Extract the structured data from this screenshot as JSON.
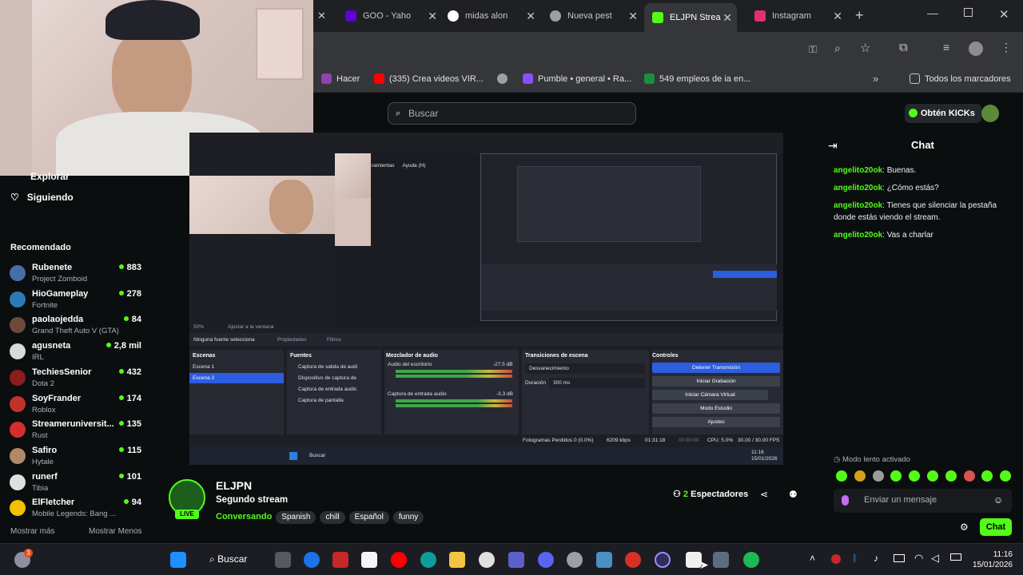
{
  "browser": {
    "tabs": [
      {
        "label": "GOO - Yaho",
        "fav_color": "#6001d2"
      },
      {
        "label": "midas alon",
        "fav_color": "#ffffff"
      },
      {
        "label": "Nueva pest",
        "fav_color": "#9aa0a6"
      },
      {
        "label": "ELJPN Strea",
        "fav_color": "#53fc18"
      },
      {
        "label": "Instagram",
        "fav_color": "#e1306c"
      }
    ],
    "bookmarks": [
      {
        "label": "Hacer",
        "color": "#8e44ad"
      },
      {
        "label": "(335) Crea videos VIR...",
        "color": "#ff0000"
      },
      {
        "label": "Pumble • general • Ra...",
        "color": "#8a4fff"
      },
      {
        "label": "549 empleos de ia en...",
        "color": "#1e8e3e"
      }
    ],
    "all_bookmarks": "Todos los marcadores"
  },
  "header": {
    "search_placeholder": "Buscar",
    "get_kicks": "Obtén KICKs"
  },
  "sidebar": {
    "explore": "Explorar",
    "following": "Siguiendo",
    "recommended": "Recomendado",
    "channels": [
      {
        "name": "Rubenete",
        "game": "Project Zomboid",
        "viewers": "883",
        "color": "#4a6da7"
      },
      {
        "name": "HioGameplay",
        "game": "Fortnite",
        "viewers": "278",
        "color": "#2d7ab5"
      },
      {
        "name": "paolaojedda",
        "game": "Grand Theft Auto V (GTA)",
        "viewers": "84",
        "color": "#6b4a3a"
      },
      {
        "name": "agusneta",
        "game": "IRL",
        "viewers": "2,8 mil",
        "color": "#d9d9d9"
      },
      {
        "name": "TechiesSenior",
        "game": "Dota 2",
        "viewers": "432",
        "color": "#8c1d1d"
      },
      {
        "name": "SoyFrander",
        "game": "Roblox",
        "viewers": "174",
        "color": "#c4302b"
      },
      {
        "name": "Streameruniversit...",
        "game": "Rust",
        "viewers": "135",
        "color": "#d32f2f"
      },
      {
        "name": "Safiro",
        "game": "Hytale",
        "viewers": "115",
        "color": "#b08968"
      },
      {
        "name": "runerf",
        "game": "Tibia",
        "viewers": "101",
        "color": "#e0e0e0"
      },
      {
        "name": "ElFletcher",
        "game": "Mobile Legends: Bang ...",
        "viewers": "94",
        "color": "#f2c200"
      }
    ],
    "show_more": "Mostrar más",
    "show_less": "Mostrar Menos"
  },
  "obs": {
    "menu": [
      "ramientas",
      "Ayuda (H)"
    ],
    "no_source": "Ninguna fuente selecciona",
    "properties": "Propiedades",
    "filters": "Filtros",
    "zoom": "50%",
    "fit": "Ajustar a la ventana",
    "scenes_title": "Escenas",
    "scenes": [
      "Escena 1",
      "Escena 2"
    ],
    "sources_title": "Fuentes",
    "sources": [
      "Captura de salida de audi",
      "Dispositivo de captura de",
      "Captura de entrada audic",
      "Captura de pantalla"
    ],
    "mixer_title": "Mezclador de audio",
    "mixer": [
      {
        "name": "Audio del escritorio",
        "db": "-27.5 dB"
      },
      {
        "name": "Captura de entrada audio",
        "db": "-3.3 dB"
      }
    ],
    "transitions_title": "Transiciones de escena",
    "transition": "Desvanecimiento",
    "duration_label": "Duración",
    "duration": "300 ms",
    "controls_title": "Controles",
    "controls": [
      "Detener Transmisión",
      "Iniciar Grabación",
      "Iniciar Cámara Virtual",
      "Modo Estudio",
      "Ajustes"
    ],
    "status": {
      "dropped": "Fotogramas Perdidos 0 (0.0%)",
      "kbps": "6209 kbps",
      "live": "01:31:18",
      "rec": "00:00:00",
      "cpu": "CPU: 5.0%",
      "fps": "30.00 / 30.00 FPS"
    },
    "taskbar": {
      "search": "Buscar",
      "time": "11:16",
      "date": "15/01/2026"
    }
  },
  "chat": {
    "title": "Chat",
    "messages": [
      {
        "user": "angelito20ok",
        "text": ": Buenas."
      },
      {
        "user": "angelito20ok",
        "text": ": ¿Cómo estás?"
      },
      {
        "user": "angelito20ok",
        "text": ": Tienes que silenciar la pestaña donde estás viendo el stream."
      },
      {
        "user": "angelito20ok",
        "text": ": Vas a charlar"
      }
    ],
    "slow_mode": "Modo lento activado",
    "input_placeholder": "Enviar un mensaje",
    "send": "Chat"
  },
  "stream": {
    "channel": "ELJPN",
    "title": "Segundo stream",
    "category": "Conversando",
    "tags": [
      "Spanish",
      "chill",
      "Español",
      "funny"
    ],
    "viewers_count": "2",
    "viewers_label": "Espectadores",
    "live_badge": "LIVE"
  },
  "taskbar": {
    "search": "Buscar",
    "time": "11:16",
    "date": "15/01/2026",
    "notif": "3"
  }
}
